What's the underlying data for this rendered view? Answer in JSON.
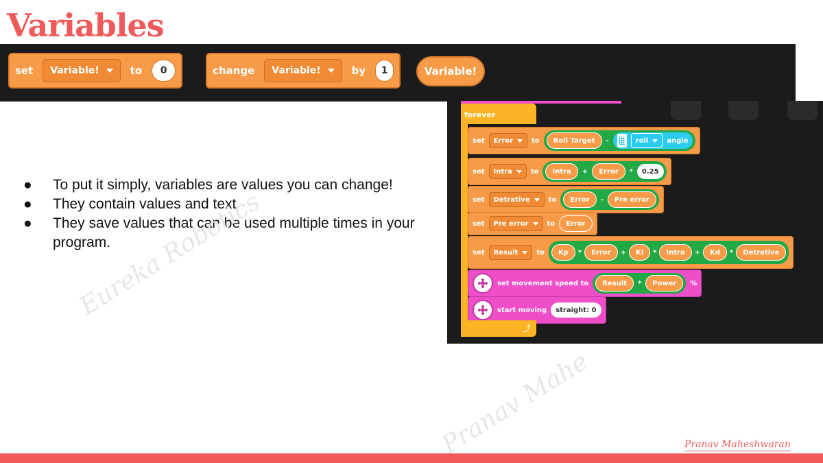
{
  "title": "Variables",
  "top_blocks": {
    "set_word": "set",
    "set_var": "Variable!",
    "to_word": "to",
    "set_value": "0",
    "change_word": "change",
    "change_var": "Variable!",
    "by_word": "by",
    "change_value": "1",
    "reporter": "Variable!"
  },
  "bullets": [
    "To put it simply, variables are values you can change!",
    "They contain values and text",
    "They save values that can be used multiple times in your program."
  ],
  "bullet_symbol": "●",
  "watermarks": [
    "Eureka Robotics",
    "Pranav Mahe"
  ],
  "code": {
    "forever": "forever",
    "set": "set",
    "to": "to",
    "loop_arrow": "⤴",
    "row1": {
      "var": "Error",
      "a": "Roll Target",
      "op": "-",
      "sensor_sel": "roll",
      "sensor_word": "angle"
    },
    "row2": {
      "var": "Intra",
      "a": "Intra",
      "op1": "+",
      "b": "Error",
      "op2": "*",
      "num": "0.25"
    },
    "row3": {
      "var": "Detrative",
      "a": "Error",
      "op": "-",
      "b": "Pre error"
    },
    "row4": {
      "var": "Pre error",
      "a": "Error"
    },
    "row5": {
      "var": "Result",
      "a": "Kp",
      "op1": "*",
      "b": "Error",
      "op2": "+",
      "c": "Ki",
      "op3": "*",
      "d": "Intra",
      "op4": "+",
      "e": "Kd",
      "op5": "*",
      "f": "Detrative"
    },
    "row6": {
      "label": "set movement speed to",
      "a": "Result",
      "op": "*",
      "b": "Power",
      "unit": "%"
    },
    "row7": {
      "label": "start moving",
      "value": "straight: 0"
    }
  },
  "author": "Pranav Maheshwaran",
  "colors": {
    "accent": "#f05a5b",
    "orange_block": "#f79b48",
    "yellow_block": "#fbb524",
    "pink_block": "#ee4ec8",
    "green_group": "#22a845",
    "cyan_block": "#2ccbf0",
    "dark_bg": "#1b1b1b"
  }
}
